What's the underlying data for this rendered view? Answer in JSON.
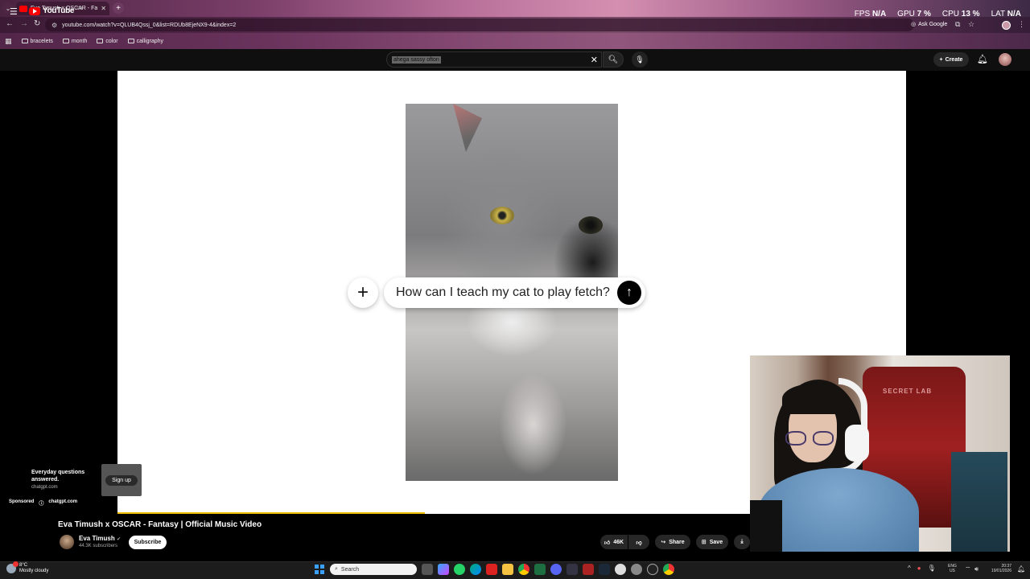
{
  "overlay": {
    "fps_label": "FPS",
    "fps_value": "N/A",
    "gpu_label": "GPU",
    "gpu_value": "7 %",
    "cpu_label": "CPU",
    "cpu_value": "13 %",
    "lat_label": "LAT",
    "lat_value": "N/A"
  },
  "browser": {
    "tab_title": "Eva Timush x OSCAR - Fantasy",
    "url": "youtube.com/watch?v=QLUB4Qssj_0&list=RDUb8EjeNX9-4&index=2",
    "ask_google": "Ask Google",
    "bookmarks": [
      "bracelets",
      "month",
      "color",
      "calligraphy"
    ]
  },
  "youtube": {
    "logo_text": "YouTube",
    "logo_country": "GB",
    "search_query": "ahega sassy ofton",
    "create_label": "Create"
  },
  "ad_overlay": {
    "prompt_text": "How can I teach my cat to play fetch?"
  },
  "sponsored": {
    "headline": "Everyday questions answered.",
    "domain": "chatgpt.com",
    "signup_label": "Sign up",
    "sponsored_label": "Sponsored",
    "bottom_domain": "chatgpt.com"
  },
  "video": {
    "title": "Eva Timush x OSCAR - Fantasy | Official Music Video",
    "channel_name": "Eva Timush",
    "subscribers": "44.3K subscribers",
    "subscribe_label": "Subscribe",
    "likes": "46K",
    "share_label": "Share",
    "save_label": "Save",
    "progress_percent": 39
  },
  "webcam": {
    "chair_brand": "SECRET LAB"
  },
  "taskbar": {
    "weather_temp": "8°C",
    "weather_desc": "Mostly cloudy",
    "search_placeholder": "Search",
    "lang_top": "ENG",
    "lang_bottom": "US",
    "time": "20:37",
    "date": "19/01/2026"
  }
}
